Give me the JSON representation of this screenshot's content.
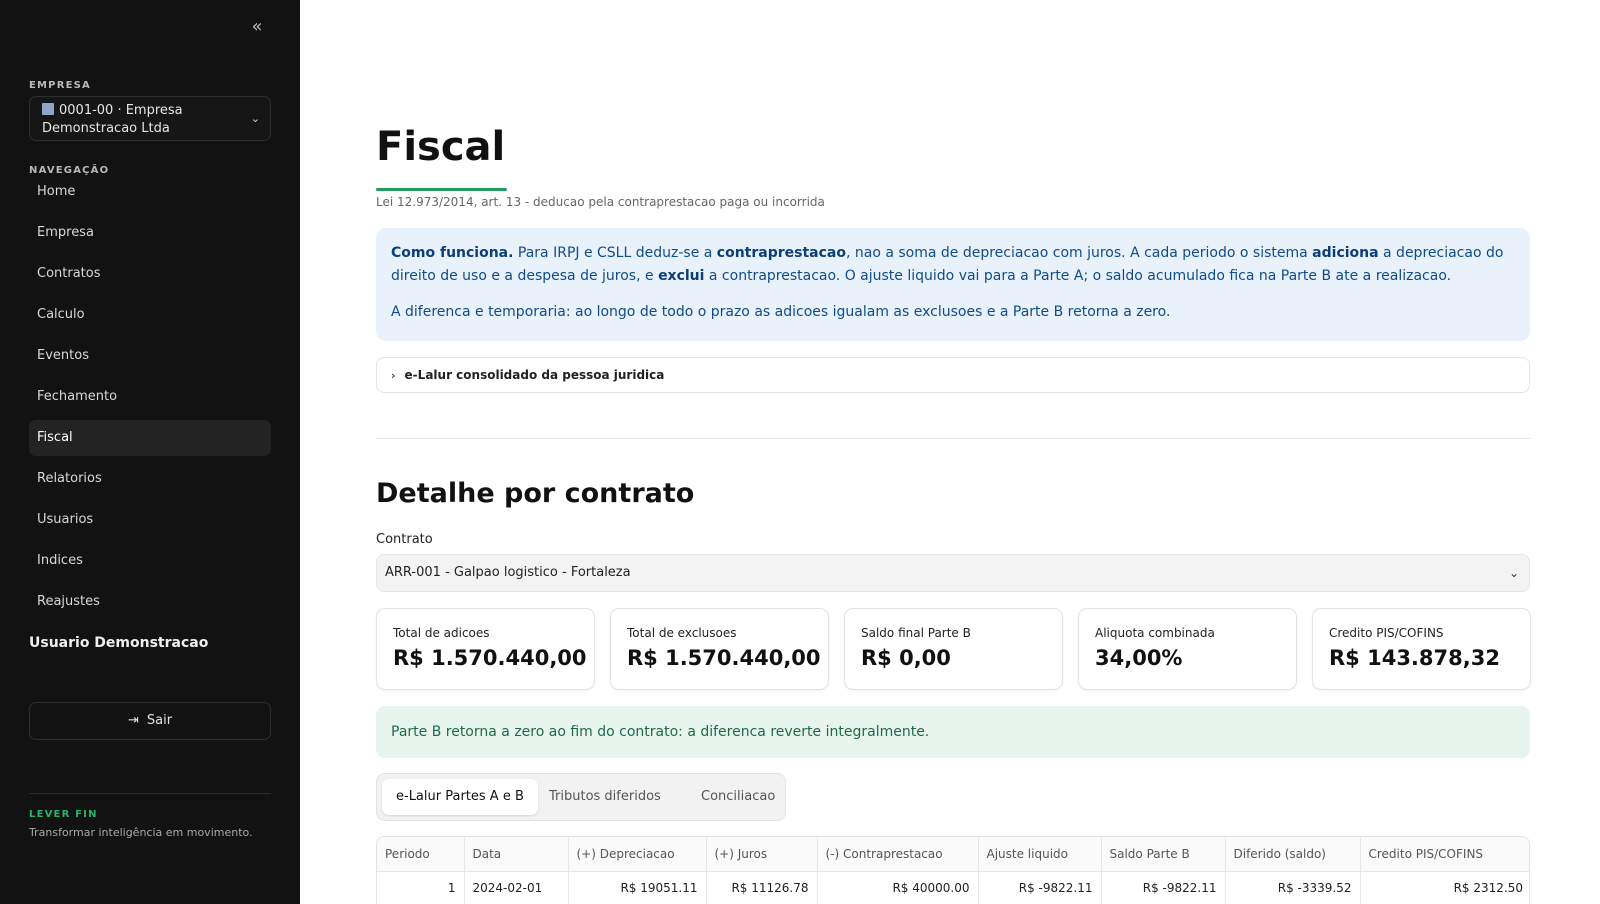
{
  "sidebar": {
    "company_section_label": "EMPRESA",
    "company_select": "0001-00 · Empresa Demonstracao Ltda",
    "nav_section_label": "NAVEGAÇÃO",
    "nav_items": [
      {
        "label": "Home"
      },
      {
        "label": "Empresa"
      },
      {
        "label": "Contratos"
      },
      {
        "label": "Calculo"
      },
      {
        "label": "Eventos"
      },
      {
        "label": "Fechamento"
      },
      {
        "label": "Fiscal",
        "active": true
      },
      {
        "label": "Relatorios"
      },
      {
        "label": "Usuarios"
      },
      {
        "label": "Indices"
      },
      {
        "label": "Reajustes"
      }
    ],
    "user_name": "Usuario Demonstracao",
    "logout_label": "Sair",
    "brand": "LEVER FIN",
    "tagline": "Transformar inteligência em movimento."
  },
  "page": {
    "title": "Fiscal",
    "subtitle": "Lei 12.973/2014, art. 13 - deducao pela contraprestacao paga ou incorrida"
  },
  "info": {
    "p1": [
      {
        "text": "Como funciona.",
        "bold": true
      },
      {
        "text": " Para IRPJ e CSLL deduz-se a "
      },
      {
        "text": "contraprestacao",
        "bold": true
      },
      {
        "text": ", nao a soma de depreciacao com juros. A cada periodo o sistema "
      },
      {
        "text": "adiciona",
        "bold": true
      },
      {
        "text": " a depreciacao do direito de uso e a despesa de juros, e "
      },
      {
        "text": "exclui",
        "bold": true
      },
      {
        "text": " a contraprestacao. O ajuste liquido vai para a Parte A; o saldo acumulado fica na Parte B ate a realizacao."
      }
    ],
    "p2": "A diferenca e temporaria: ao longo de todo o prazo as adicoes igualam as exclusoes e a Parte B retorna a zero."
  },
  "accordion_label": "e-Lalur consolidado da pessoa juridica",
  "detail": {
    "title": "Detalhe por contrato",
    "contract_label": "Contrato",
    "contract_value": "ARR-001 - Galpao logistico - Fortaleza"
  },
  "cards": [
    {
      "label": "Total de adicoes",
      "value": "R$ 1.570.440,00"
    },
    {
      "label": "Total de exclusoes",
      "value": "R$ 1.570.440,00"
    },
    {
      "label": "Saldo final Parte B",
      "value": "R$ 0,00"
    },
    {
      "label": "Aliquota combinada",
      "value": "34,00%"
    },
    {
      "label": "Credito PIS/COFINS",
      "value": "R$ 143.878,32"
    }
  ],
  "success_message": "Parte B retorna a zero ao fim do contrato: a diferenca reverte integralmente.",
  "tabs": [
    {
      "label": "e-Lalur Partes A e B",
      "active": true
    },
    {
      "label": "Tributos diferidos"
    },
    {
      "label": "Conciliacao"
    }
  ],
  "table": {
    "headers": [
      "Periodo",
      "Data",
      "(+) Depreciacao",
      "(+) Juros",
      "(-) Contraprestacao",
      "Ajuste liquido",
      "Saldo Parte B",
      "Diferido (saldo)",
      "Credito PIS/COFINS"
    ],
    "rows": [
      [
        "1",
        "2024-02-01",
        "R$ 19051.11",
        "R$ 11126.78",
        "R$ 40000.00",
        "R$ -9822.11",
        "R$ -9822.11",
        "R$ -3339.52",
        "R$ 2312.50"
      ]
    ]
  }
}
